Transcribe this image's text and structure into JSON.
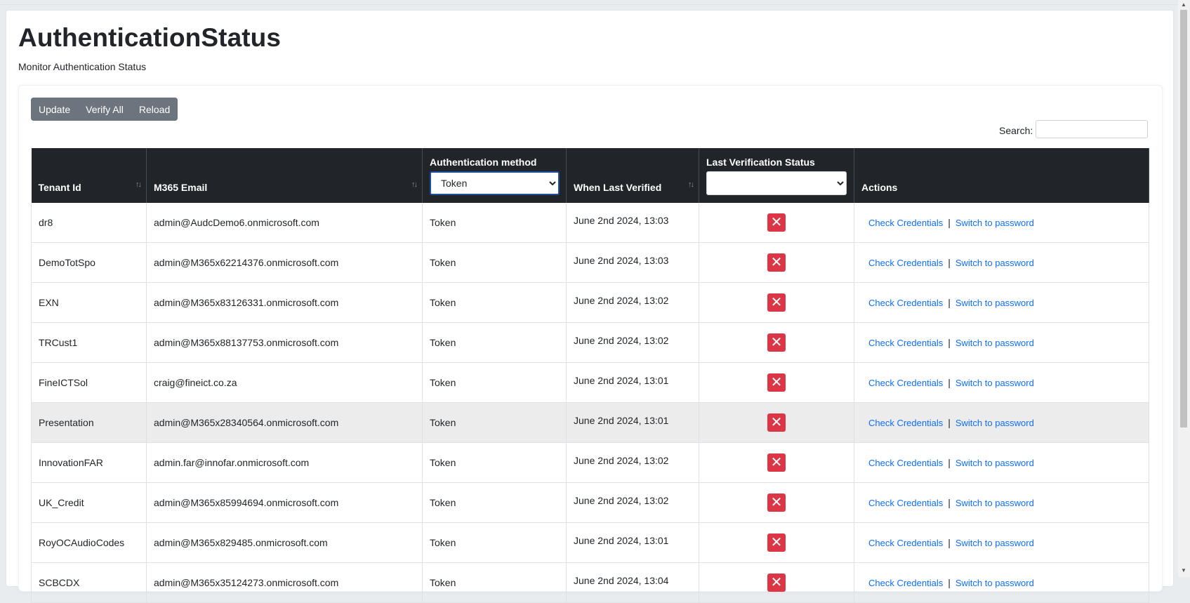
{
  "page": {
    "title": "AuthenticationStatus",
    "subtitle": "Monitor Authentication Status"
  },
  "toolbar": {
    "update_label": "Update",
    "verify_all_label": "Verify All",
    "reload_label": "Reload"
  },
  "search": {
    "label": "Search:",
    "value": ""
  },
  "table": {
    "headers": {
      "tenant_id": "Tenant Id",
      "email": "M365 Email",
      "auth_method": "Authentication method",
      "last_verified": "When Last Verified",
      "last_status": "Last Verification Status",
      "actions": "Actions"
    },
    "filters": {
      "auth_method_selected": "Token",
      "last_status_selected": ""
    },
    "rows": [
      {
        "tenant": "dr8",
        "email": "admin@AudcDemo6.onmicrosoft.com",
        "method": "Token",
        "verified": "June 2nd 2024, 13:03",
        "status": "failed"
      },
      {
        "tenant": "DemoTotSpo",
        "email": "admin@M365x62214376.onmicrosoft.com",
        "method": "Token",
        "verified": "June 2nd 2024, 13:03",
        "status": "failed"
      },
      {
        "tenant": "EXN",
        "email": "admin@M365x83126331.onmicrosoft.com",
        "method": "Token",
        "verified": "June 2nd 2024, 13:02",
        "status": "failed"
      },
      {
        "tenant": "TRCust1",
        "email": "admin@M365x88137753.onmicrosoft.com",
        "method": "Token",
        "verified": "June 2nd 2024, 13:02",
        "status": "failed"
      },
      {
        "tenant": "FineICTSol",
        "email": "craig@fineict.co.za",
        "method": "Token",
        "verified": "June 2nd 2024, 13:01",
        "status": "failed"
      },
      {
        "tenant": "Presentation",
        "email": "admin@M365x28340564.onmicrosoft.com",
        "method": "Token",
        "verified": "June 2nd 2024, 13:01",
        "status": "failed"
      },
      {
        "tenant": "InnovationFAR",
        "email": "admin.far@innofar.onmicrosoft.com",
        "method": "Token",
        "verified": "June 2nd 2024, 13:02",
        "status": "failed"
      },
      {
        "tenant": "UK_Credit",
        "email": "admin@M365x85994694.onmicrosoft.com",
        "method": "Token",
        "verified": "June 2nd 2024, 13:02",
        "status": "failed"
      },
      {
        "tenant": "RoyOCAudioCodes",
        "email": "admin@M365x829485.onmicrosoft.com",
        "method": "Token",
        "verified": "June 2nd 2024, 13:01",
        "status": "failed"
      },
      {
        "tenant": "SCBCDX",
        "email": "admin@M365x35124273.onmicrosoft.com",
        "method": "Token",
        "verified": "June 2nd 2024, 13:04",
        "status": "failed"
      }
    ],
    "hovered_row_index": 5,
    "status_icons": {
      "failed": "✕"
    },
    "row_actions": {
      "check_label": "Check Credentials",
      "separator": "|",
      "switch_label": "Switch to password"
    }
  },
  "colors": {
    "header_bg": "#212529",
    "status_failed": "#dc3545",
    "link": "#0d6efd",
    "button_bg": "#6c757d"
  }
}
